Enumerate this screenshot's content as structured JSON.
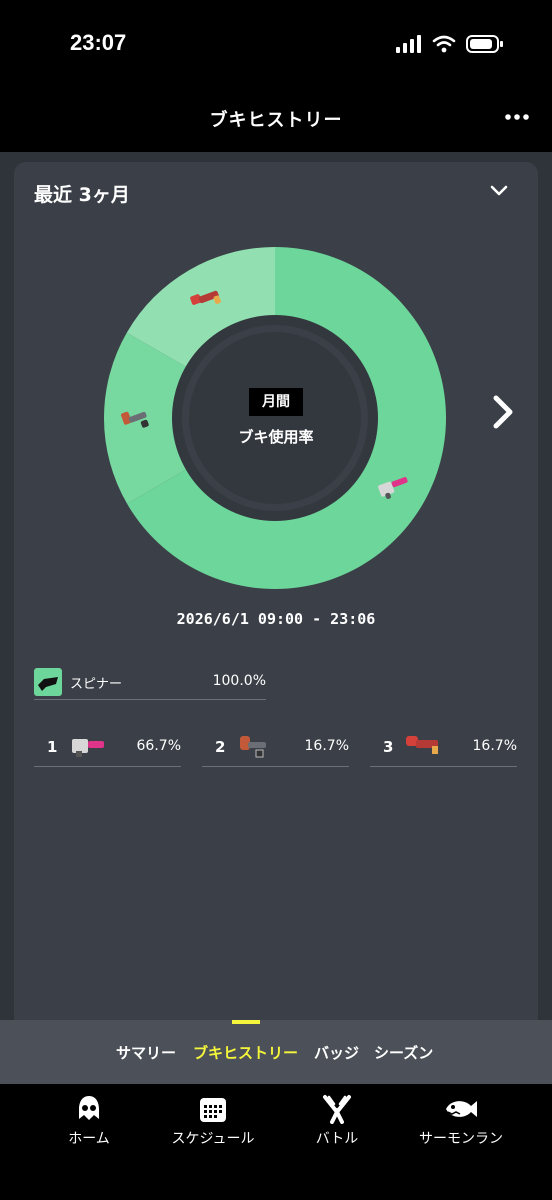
{
  "status": {
    "time": "23:07"
  },
  "header": {
    "title": "ブキヒストリー"
  },
  "card": {
    "period": "最近 3ヶ月",
    "center_tag": "月間",
    "center_label": "ブキ使用率",
    "date_range": "2026/6/1 09:00 - 23:06"
  },
  "chart_data": {
    "type": "pie",
    "categories": [
      "1",
      "2",
      "3"
    ],
    "values": [
      66.7,
      16.7,
      16.7
    ],
    "colors": [
      "#6dd69a",
      "#77d9a0",
      "#92e0b1"
    ]
  },
  "category": {
    "label": "スピナー",
    "percent": "100.0%",
    "color": "#6dd69a"
  },
  "ranking": [
    {
      "rank": "1",
      "percent": "66.7%"
    },
    {
      "rank": "2",
      "percent": "16.7%"
    },
    {
      "rank": "3",
      "percent": "16.7%"
    }
  ],
  "sub_tabs": [
    "サマリー",
    "ブキヒストリー",
    "バッジ",
    "シーズン"
  ],
  "active_sub_tab": "ブキヒストリー",
  "nav": [
    "ホーム",
    "スケジュール",
    "バトル",
    "サーモンラン"
  ],
  "icons": {
    "signal": "signal-icon",
    "wifi": "wifi-icon",
    "battery": "battery-icon",
    "more": "more-icon",
    "dropdown": "chevron-down-icon",
    "next": "chevron-right-icon",
    "home": "squid-icon",
    "schedule": "calendar-icon",
    "battle": "crossed-claws-icon",
    "salmon": "fish-icon"
  }
}
